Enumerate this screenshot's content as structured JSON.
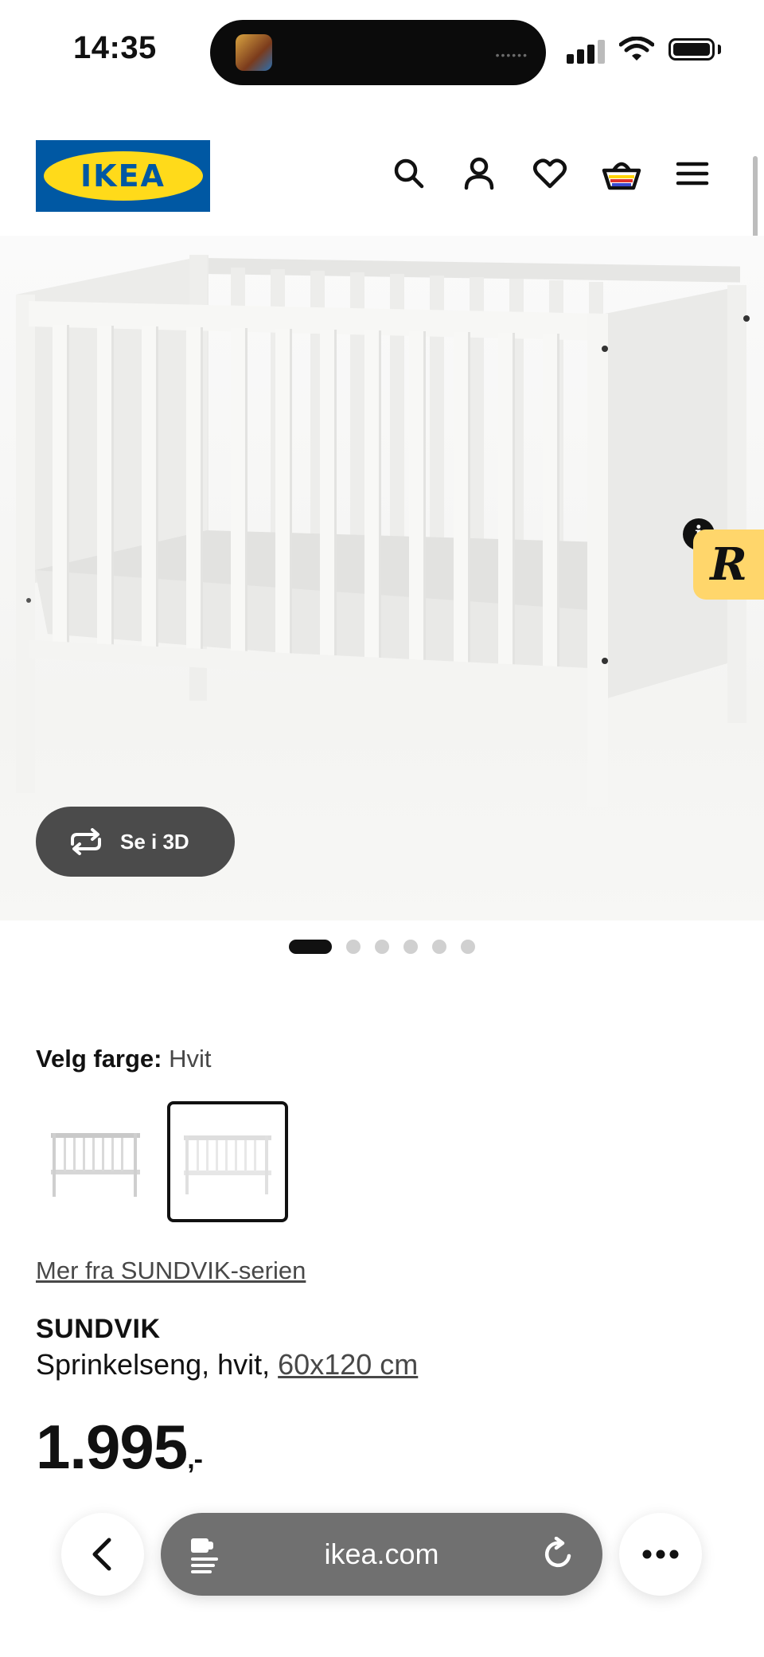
{
  "status_bar": {
    "time": "14:35"
  },
  "header": {
    "logo_text": "IKEA",
    "brand_colors": {
      "blue": "#0058a3",
      "yellow": "#ffda1a"
    },
    "icons": [
      "search-icon",
      "account-icon",
      "heart-icon",
      "basket-icon",
      "menu-icon"
    ]
  },
  "gallery": {
    "view_3d_label": "Se i 3D",
    "slide_count": 6,
    "active_slide": 1
  },
  "overlay_badge": {
    "letter": "R",
    "info": "i"
  },
  "color_picker": {
    "label": "Velg farge:",
    "selected": "Hvit",
    "options": [
      "grey-white",
      "white"
    ],
    "selected_index": 1
  },
  "series_link": "Mer fra SUNDVIK-serien",
  "product": {
    "name": "SUNDVIK",
    "description": "Sprinkelseng, hvit, ",
    "size": "60x120 cm",
    "price": "1.995",
    "price_suffix": ",-"
  },
  "browser": {
    "url": "ikea.com"
  }
}
